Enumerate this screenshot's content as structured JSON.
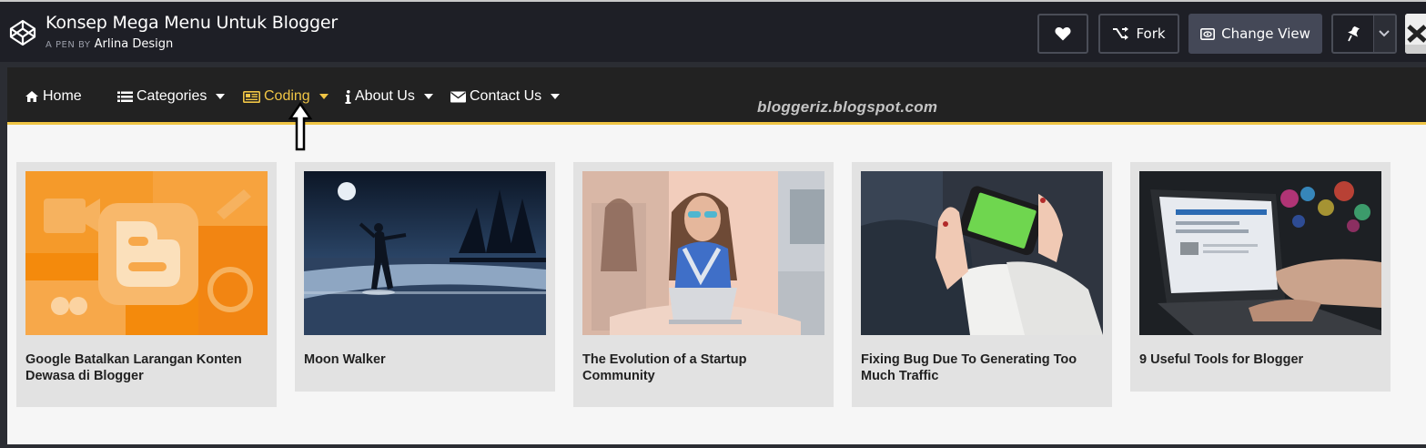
{
  "pen": {
    "title": "Konsep Mega Menu Untuk Blogger",
    "by_prefix": "A PEN BY",
    "author": "Arlina Design"
  },
  "header_buttons": {
    "heart_icon": "heart-icon",
    "fork_label": "Fork",
    "change_view_label": "Change View",
    "pin_icon": "pin-icon"
  },
  "navbar": {
    "items": [
      {
        "label": "Home",
        "icon": "home-icon",
        "has_caret": false
      },
      {
        "label": "Categories",
        "icon": "list-icon",
        "has_caret": true
      },
      {
        "label": "Coding",
        "icon": "newspaper-icon",
        "has_caret": true,
        "active": true
      },
      {
        "label": "About Us",
        "icon": "info-icon",
        "has_caret": true
      },
      {
        "label": "Contact Us",
        "icon": "envelope-icon",
        "has_caret": true
      }
    ],
    "watermark": "bloggeriz.blogspot.com"
  },
  "posts": [
    {
      "title": "Google Batalkan Larangan Konten Dewasa di Blogger",
      "image": "blogger-logo-orange"
    },
    {
      "title": "Moon Walker",
      "image": "night-road-moon"
    },
    {
      "title": "The Evolution of a Startup Community",
      "image": "woman-with-laptop"
    },
    {
      "title": "Fixing Bug Due To Generating Too Much Traffic",
      "image": "hands-holding-phone"
    },
    {
      "title": "9 Useful Tools for Blogger",
      "image": "laptop-typing"
    }
  ],
  "colors": {
    "header_bg": "#1e1f26",
    "nav_bg": "#222222",
    "accent": "#f0c545",
    "card_bg": "#e2e2e2",
    "preview_bg": "#f6f6f6"
  }
}
